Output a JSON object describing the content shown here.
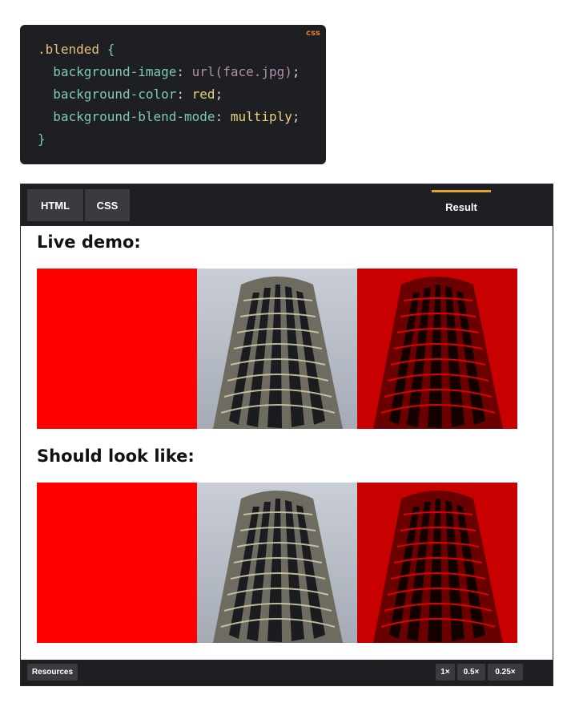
{
  "code": {
    "lang": "css",
    "selector": ".blended",
    "open_brace": "{",
    "close_brace": "}",
    "lines": [
      {
        "prop": "background-image",
        "value": "url(face.jpg)"
      },
      {
        "prop": "background-color",
        "value": "red"
      },
      {
        "prop": "background-blend-mode",
        "value": "multiply"
      }
    ]
  },
  "embed": {
    "tabs": {
      "html": "HTML",
      "css": "CSS",
      "result": "Result"
    },
    "headings": {
      "live_demo": "Live demo:",
      "should_look_like": "Should look like:"
    },
    "footer": {
      "resources": "Resources",
      "zoom_1x": "1×",
      "zoom_05x": "0.5×",
      "zoom_025x": "0.25×"
    },
    "colors": {
      "accent": "#e9a12b",
      "red": "#ff0000",
      "dark": "#1e1f22"
    }
  }
}
